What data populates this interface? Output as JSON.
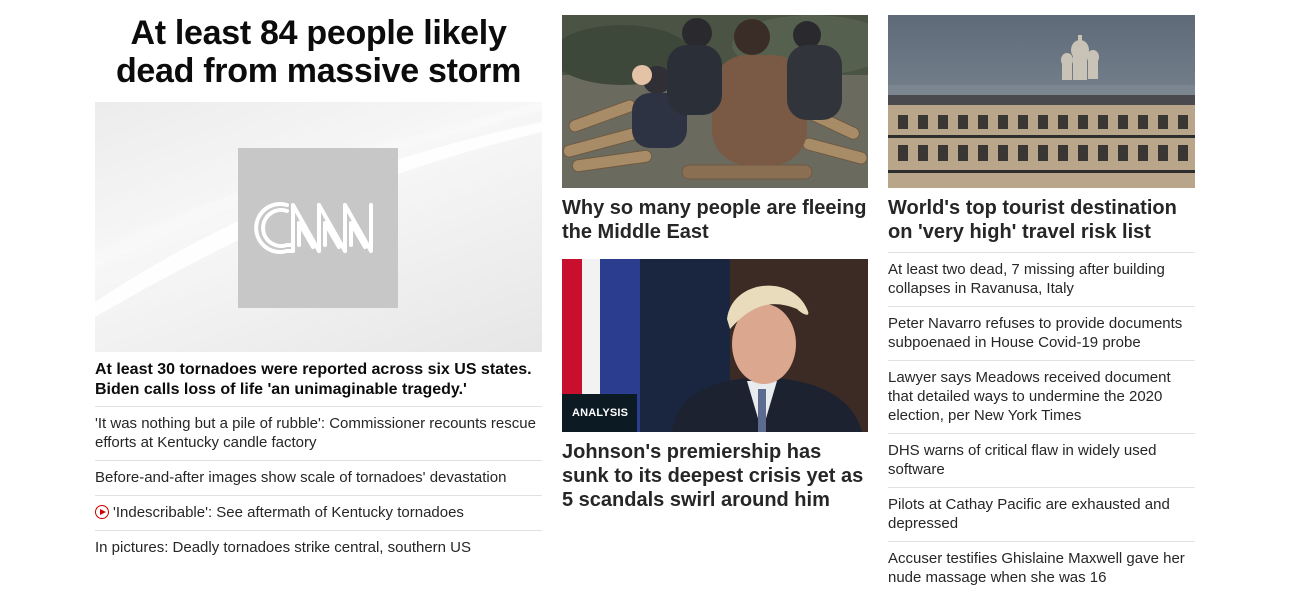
{
  "lead": {
    "headline": "At least 84 people likely dead from massive storm",
    "logo_text": "CNN",
    "caption": "At least 30 tornadoes were reported across six US states. Biden calls loss of life 'an unimaginable tragedy.'",
    "links": [
      {
        "text": "'It was nothing but a pile of rubble': Commissioner recounts rescue efforts at Kentucky candle factory",
        "video": false
      },
      {
        "text": "Before-and-after images show scale of tornadoes' devastation",
        "video": false
      },
      {
        "text": "'Indescribable': See aftermath of Kentucky tornadoes",
        "video": true,
        "icon": "play-circle-icon"
      },
      {
        "text": "In pictures: Deadly tornadoes strike central, southern US",
        "video": false
      }
    ]
  },
  "middle": {
    "card1": {
      "title": "Why so many people are fleeing the Middle East"
    },
    "card2": {
      "badge": "ANALYSIS",
      "title": "Johnson's premiership has sunk to its deepest crisis yet as 5 scandals swirl around him"
    }
  },
  "right": {
    "card": {
      "title": "World's top tourist destination on 'very high' travel risk list"
    },
    "links": [
      "At least two dead, 7 missing after building collapses in Ravanusa, Italy",
      "Peter Navarro refuses to provide documents subpoenaed in House Covid-19 probe",
      "Lawyer says Meadows received document that detailed ways to undermine the 2020 election, per New York Times",
      "DHS warns of critical flaw in widely used software",
      "Pilots at Cathay Pacific are exhausted and depressed",
      "Accuser testifies Ghislaine Maxwell gave her nude massage when she was 16"
    ]
  },
  "colors": {
    "text": "#0c0c0c",
    "link_text": "#262626",
    "divider": "#e1e1e1",
    "accent_red": "#cc0000",
    "badge_bg": "#0c1a24",
    "logo_square": "#c7c7c8"
  }
}
